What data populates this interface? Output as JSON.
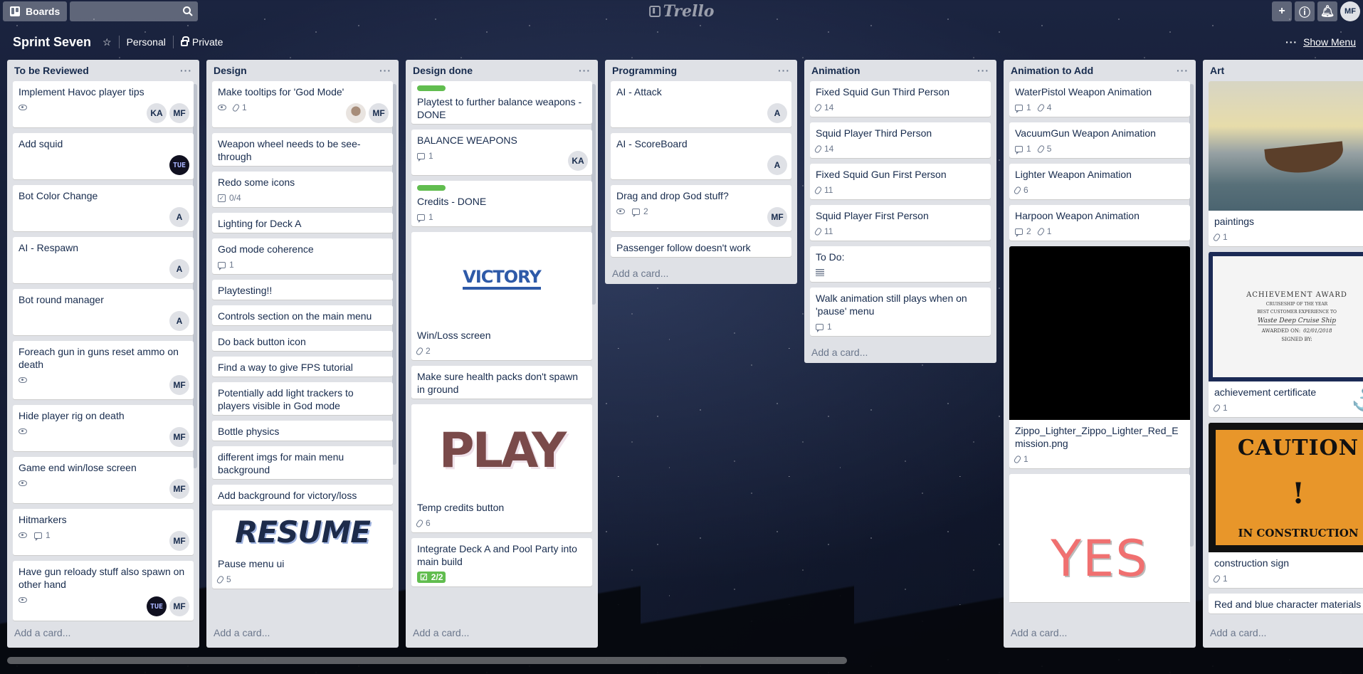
{
  "topbar": {
    "boards_label": "Boards",
    "search_placeholder": "",
    "logo_text": "Trello",
    "add_icon": "plus-icon",
    "info_icon": "info-icon",
    "bell_icon": "bell-icon",
    "user_initials": "MF"
  },
  "board": {
    "title": "Sprint Seven",
    "team": "Personal",
    "visibility": "Private",
    "show_menu": "Show Menu"
  },
  "add_card_label": "Add a card...",
  "lists": [
    {
      "title": "To be Reviewed",
      "cards": [
        {
          "title": "Implement Havoc player tips",
          "watch": true,
          "members": [
            "KA",
            "MF"
          ]
        },
        {
          "title": "Add squid",
          "members": [
            "TUE"
          ]
        },
        {
          "title": "Bot Color Change",
          "members": [
            "A"
          ]
        },
        {
          "title": "AI - Respawn",
          "members": [
            "A"
          ]
        },
        {
          "title": "Bot round manager",
          "members": [
            "A"
          ]
        },
        {
          "title": "Foreach gun in guns reset ammo on death",
          "watch": true,
          "members": [
            "MF"
          ]
        },
        {
          "title": "Hide player rig on death",
          "watch": true,
          "members": [
            "MF"
          ]
        },
        {
          "title": "Game end win/lose screen",
          "watch": true,
          "members": [
            "MF"
          ]
        },
        {
          "title": "Hitmarkers",
          "watch": true,
          "comments": "1",
          "members": [
            "MF"
          ]
        },
        {
          "title": "Have gun reloady stuff also spawn on other hand",
          "watch": true,
          "members": [
            "TUE",
            "MF"
          ]
        }
      ]
    },
    {
      "title": "Design",
      "cards": [
        {
          "title": "Make tooltips for 'God Mode'",
          "watch": true,
          "attachments": "1",
          "members": [
            "IMG",
            "MF"
          ]
        },
        {
          "title": "Weapon wheel needs to be see-through"
        },
        {
          "title": "Redo some icons",
          "checklist": "0/4"
        },
        {
          "title": "Lighting for Deck A"
        },
        {
          "title": "God mode coherence",
          "comments": "1"
        },
        {
          "title": "Playtesting!!"
        },
        {
          "title": "Controls section on the main menu"
        },
        {
          "title": "Do back button icon"
        },
        {
          "title": "Find a way to give FPS tutorial"
        },
        {
          "title": "Potentially add light trackers to players visible in God mode"
        },
        {
          "title": "Bottle physics"
        },
        {
          "title": "different imgs for main menu background"
        },
        {
          "title": "Add background for victory/loss"
        },
        {
          "title": "Pause menu ui",
          "cover": "RESUME",
          "attachments": "5"
        }
      ]
    },
    {
      "title": "Design done",
      "cards": [
        {
          "title": "Playtest to further balance weapons - DONE",
          "label": "green"
        },
        {
          "title": "BALANCE WEAPONS",
          "comments": "1",
          "members": [
            "KA"
          ]
        },
        {
          "title": "Credits - DONE",
          "label": "green",
          "comments": "1"
        },
        {
          "title": "Win/Loss screen",
          "cover": "VICTORY",
          "attachments": "2"
        },
        {
          "title": "Make sure health packs don't spawn in ground"
        },
        {
          "title": "Temp credits button",
          "cover": "PLAY",
          "attachments": "6"
        },
        {
          "title": "Integrate Deck A and Pool Party into main build",
          "checklist_done": "2/2"
        }
      ]
    },
    {
      "title": "Programming",
      "cards": [
        {
          "title": "AI - Attack",
          "members": [
            "A"
          ]
        },
        {
          "title": "AI - ScoreBoard",
          "members": [
            "A"
          ]
        },
        {
          "title": "Drag and drop God stuff?",
          "watch": true,
          "comments": "2",
          "members": [
            "MF"
          ]
        },
        {
          "title": "Passenger follow doesn't work"
        }
      ]
    },
    {
      "title": "Animation",
      "cards": [
        {
          "title": "Fixed Squid Gun Third Person",
          "attachments": "14"
        },
        {
          "title": "Squid Player Third Person",
          "attachments": "14"
        },
        {
          "title": "Fixed Squid Gun First Person",
          "attachments": "11"
        },
        {
          "title": "Squid Player First Person",
          "attachments": "11"
        },
        {
          "title": "To Do:",
          "description": true
        },
        {
          "title": "Walk animation still plays when on 'pause' menu",
          "comments": "1"
        }
      ]
    },
    {
      "title": "Animation to Add",
      "cards": [
        {
          "title": "WaterPistol Weapon Animation",
          "comments": "1",
          "attachments": "4"
        },
        {
          "title": "VacuumGun Weapon Animation",
          "comments": "1",
          "attachments": "5"
        },
        {
          "title": "Lighter Weapon Animation",
          "attachments": "6"
        },
        {
          "title": "Harpoon Weapon Animation",
          "comments": "2",
          "attachments": "1"
        },
        {
          "title": "Zippo_Lighter_Zippo_Lighter_Red_Emission.png",
          "cover": "black",
          "attachments": "1"
        },
        {
          "title": "",
          "cover": "YES"
        }
      ]
    },
    {
      "title": "Art",
      "cards": [
        {
          "title": "paintings",
          "cover": "painting",
          "attachments": "1"
        },
        {
          "title": "achievement certificate",
          "cover": "certificate",
          "attachments": "1"
        },
        {
          "title": "construction sign",
          "cover": "caution",
          "attachments": "1"
        },
        {
          "title": "Red and blue character materials"
        }
      ]
    }
  ],
  "covers": {
    "resume": "RESUME",
    "victory": "VICTORY",
    "play": "PLAY",
    "yes": "YES",
    "certificate_title": "ACHIEVEMENT AWARD",
    "certificate_line1": "CRUISESHIP OF THE YEAR",
    "certificate_line2": "BEST CUSTOMER EXPERIENCE TO",
    "certificate_recipient": "Waste Deep Cruise Ship",
    "certificate_awarded_label": "AWARDED ON:",
    "certificate_date": "02/01/2018",
    "certificate_signed_label": "SIGNED BY:",
    "caution_top": "CAUTION",
    "caution_bottom": "IN CONSTRUCTION"
  },
  "colors": {
    "list_bg": "#dfe1e6",
    "label_green": "#61bd4f",
    "text": "#172b4d",
    "muted": "#6b778c"
  }
}
